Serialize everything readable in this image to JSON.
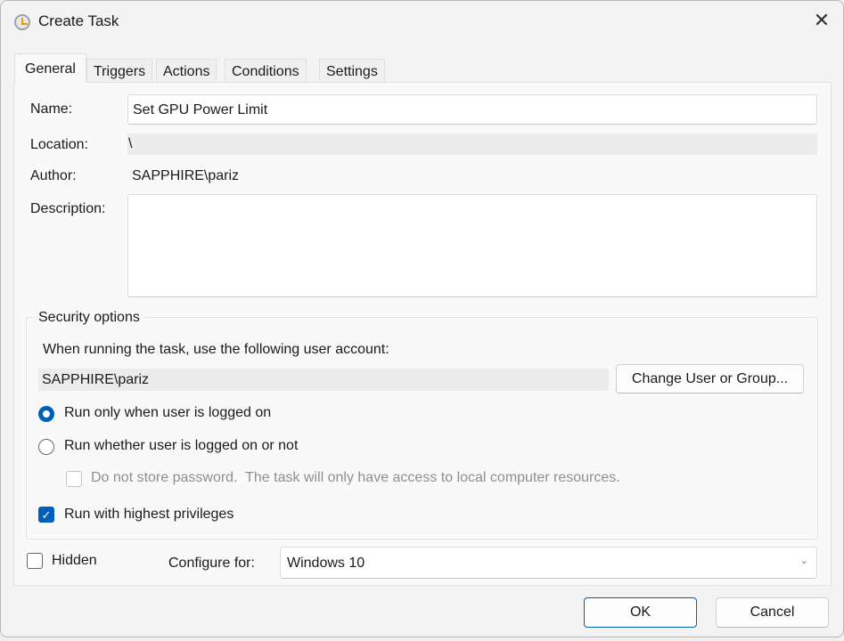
{
  "window": {
    "title": "Create Task",
    "close": "✕"
  },
  "tabs": [
    "General",
    "Triggers",
    "Actions",
    "Conditions",
    "Settings"
  ],
  "general": {
    "name_label": "Name:",
    "name_value": "Set GPU Power Limit",
    "location_label": "Location:",
    "location_value": "\\",
    "author_label": "Author:",
    "author_value": "SAPPHIRE\\pariz",
    "description_label": "Description:",
    "description_value": ""
  },
  "security": {
    "title": "Security options",
    "account_prompt": "When running the task, use the following user account:",
    "account_value": "SAPPHIRE\\pariz",
    "change_button": "Change User or Group...",
    "radio_logged_on": "Run only when user is logged on",
    "radio_whether": "Run whether user is logged on or not",
    "selected": "Run only when user is logged on",
    "no_store_password": "Do not store password.  The task will only have access to local computer resources.",
    "no_store_password_checked": false,
    "highest_privileges": "Run with highest privileges",
    "highest_privileges_checked": true
  },
  "bottom": {
    "hidden_label": "Hidden",
    "hidden_checked": false,
    "configure_label": "Configure for:",
    "configure_value": "Windows 10"
  },
  "buttons": {
    "ok": "OK",
    "cancel": "Cancel"
  },
  "colors": {
    "accent": "#005fb8"
  }
}
